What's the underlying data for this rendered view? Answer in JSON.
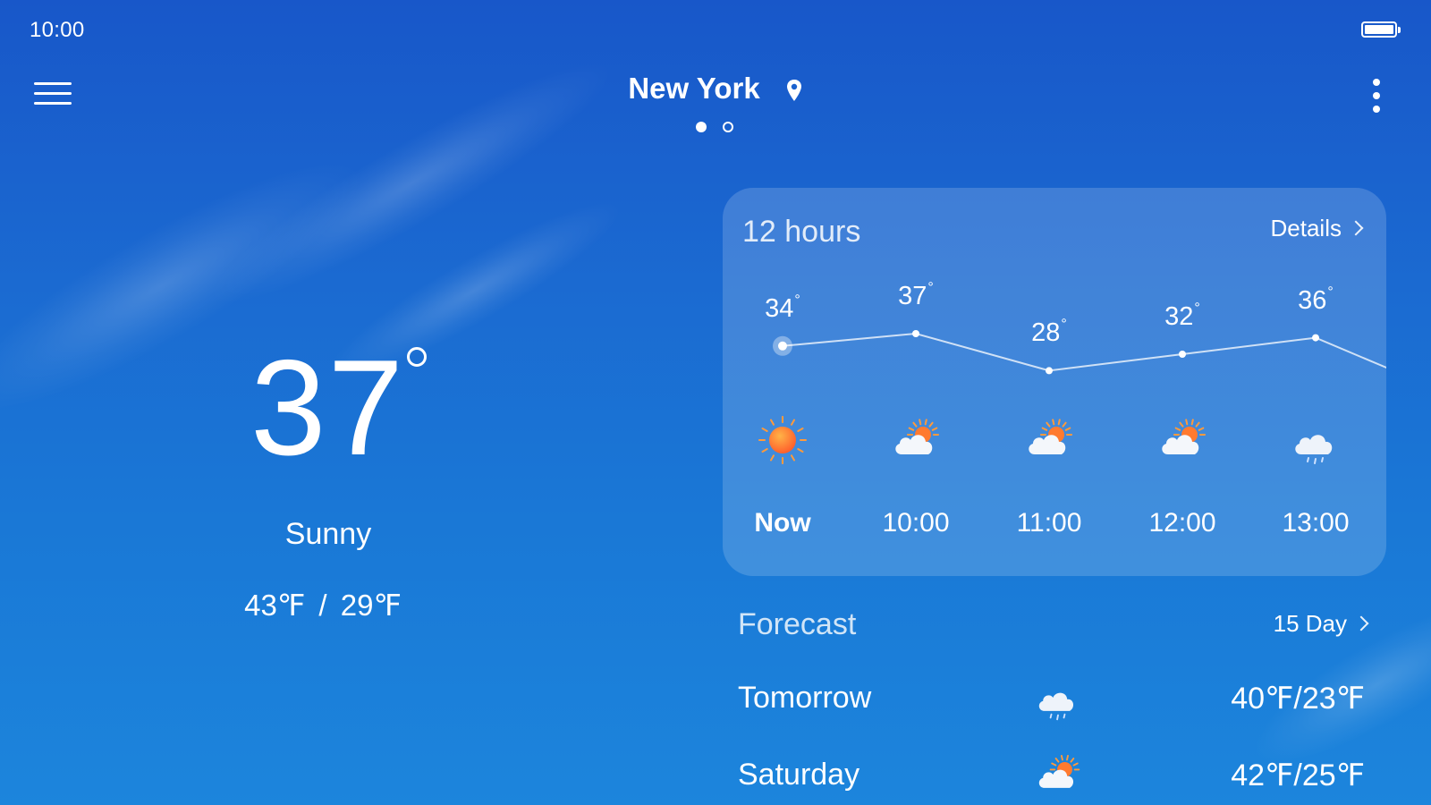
{
  "status_bar": {
    "time": "10:00",
    "battery_icon": "battery-full-icon"
  },
  "header": {
    "city": "New York",
    "menu_icon": "menu-icon",
    "location_icon": "location-pin-icon",
    "more_icon": "more-vert-icon",
    "page_count": 2,
    "active_page": 1
  },
  "current": {
    "temp": "37",
    "condition": "Sunny",
    "high_low": "43℉  /  29℉"
  },
  "hourly": {
    "title": "12 hours",
    "details_label": "Details",
    "items": [
      {
        "time": "Now",
        "temp": "34",
        "temp_value": 34,
        "icon": "sunny-icon"
      },
      {
        "time": "10:00",
        "temp": "37",
        "temp_value": 37,
        "icon": "partly-cloudy-icon"
      },
      {
        "time": "11:00",
        "temp": "28",
        "temp_value": 28,
        "icon": "partly-cloudy-icon"
      },
      {
        "time": "12:00",
        "temp": "32",
        "temp_value": 32,
        "icon": "partly-cloudy-icon"
      },
      {
        "time": "13:00",
        "temp": "36",
        "temp_value": 36,
        "icon": "rain-cloud-icon"
      }
    ],
    "degree_symbol": "°"
  },
  "forecast": {
    "title": "Forecast",
    "more_label": "15 Day",
    "days": [
      {
        "day": "Tomorrow",
        "temps": "40℉/23℉",
        "icon": "rain-cloud-icon"
      },
      {
        "day": "Saturday",
        "temps": "42℉/25℉",
        "icon": "partly-cloudy-icon"
      }
    ]
  },
  "colors": {
    "background_top": "#1857c9",
    "background_bottom": "#1c85dc",
    "sun": "#ff7a2f",
    "sun_rays": "#ff9a3c"
  }
}
